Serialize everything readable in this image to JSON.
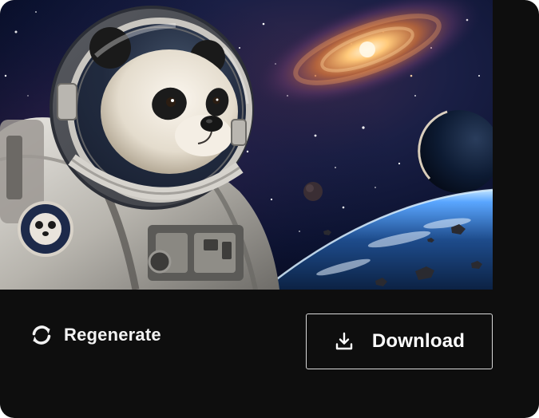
{
  "card": {
    "image": {
      "alt_icon": "astronaut-panda-image"
    },
    "actions": {
      "regenerate_label": "Regenerate",
      "regenerate_icon": "refresh-icon",
      "download_label": "Download",
      "download_icon": "download-icon"
    }
  },
  "colors": {
    "card_background": "#0e0e0e",
    "text": "#f2f2f2",
    "button_border": "#d9d9d9"
  }
}
